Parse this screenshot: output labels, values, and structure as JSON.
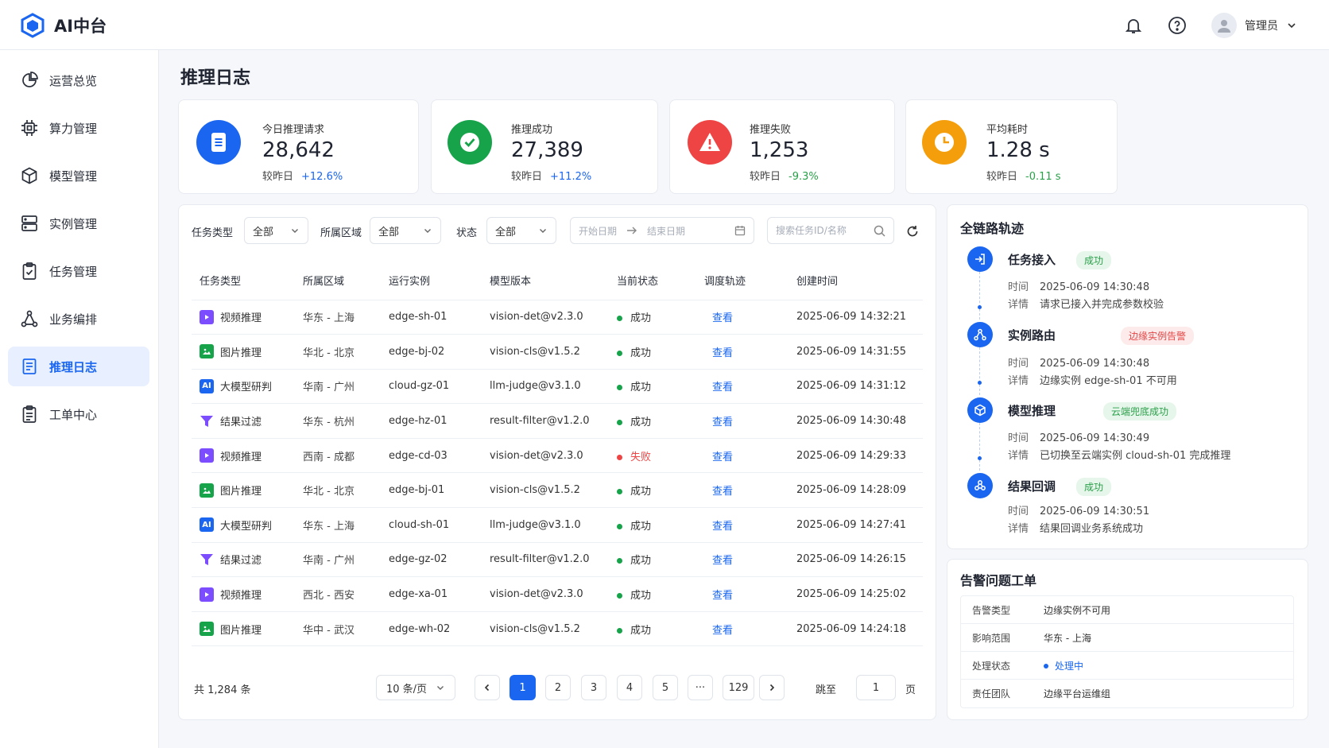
{
  "app": {
    "title": "AI中台"
  },
  "header": {
    "user_name": "管理员",
    "icons": [
      "bell-icon",
      "help-icon",
      "avatar-icon",
      "chevron-down-icon"
    ]
  },
  "sidebar": {
    "items": [
      {
        "label": "运营总览",
        "icon": "pie-chart-icon",
        "active": false
      },
      {
        "label": "算力管理",
        "icon": "cpu-icon",
        "active": false
      },
      {
        "label": "模型管理",
        "icon": "cube-icon",
        "active": false
      },
      {
        "label": "实例管理",
        "icon": "server-icon",
        "active": false
      },
      {
        "label": "任务管理",
        "icon": "clipboard-icon",
        "active": false
      },
      {
        "label": "业务编排",
        "icon": "flow-icon",
        "active": false
      },
      {
        "label": "推理日志",
        "icon": "document-icon",
        "active": true
      },
      {
        "label": "工单中心",
        "icon": "ticket-icon",
        "active": false
      }
    ]
  },
  "page": {
    "title": "推理日志"
  },
  "stats": [
    {
      "label": "今日推理请求",
      "value": "28,642",
      "compare_label": "较昨日",
      "delta": "+12.6%",
      "color": "#1a66f0",
      "icon": "document-icon"
    },
    {
      "label": "推理成功",
      "value": "27,389",
      "compare_label": "较昨日",
      "delta": "+11.2%",
      "color": "#16a34a",
      "icon": "check-circle-icon"
    },
    {
      "label": "推理失败",
      "value": "1,253",
      "compare_label": "较昨日",
      "delta": "-9.3%",
      "color": "#ef4444",
      "icon": "warning-icon"
    },
    {
      "label": "平均耗时",
      "value": "1.28 s",
      "compare_label": "较昨日",
      "delta": "-0.11 s",
      "color": "#f59e0b",
      "icon": "clock-icon"
    }
  ],
  "filters": {
    "task_type": {
      "label": "任务类型",
      "value": "全部"
    },
    "region": {
      "label": "所属区域",
      "value": "全部"
    },
    "status": {
      "label": "状态",
      "value": "全部"
    },
    "date": {
      "start_placeholder": "开始日期",
      "end_placeholder": "结束日期"
    },
    "search_placeholder": "搜索任务ID/名称"
  },
  "table": {
    "columns": [
      "任务类型",
      "所属区域",
      "运行实例",
      "模型版本",
      "当前状态",
      "调度轨迹",
      "创建时间"
    ],
    "link_label": "查看",
    "rows": [
      {
        "type": "视频推理",
        "icon": "video-icon",
        "region": "华东 - 上海",
        "instance": "edge-sh-01",
        "model": "vision-det@v2.3.0",
        "status": "成功",
        "ok": true,
        "time": "2025-06-09 14:32:21"
      },
      {
        "type": "图片推理",
        "icon": "image-icon",
        "region": "华北 - 北京",
        "instance": "edge-bj-02",
        "model": "vision-cls@v1.5.2",
        "status": "成功",
        "ok": true,
        "time": "2025-06-09 14:31:55"
      },
      {
        "type": "大模型研判",
        "icon": "ai-icon",
        "region": "华南 - 广州",
        "instance": "cloud-gz-01",
        "model": "llm-judge@v3.1.0",
        "status": "成功",
        "ok": true,
        "time": "2025-06-09 14:31:12"
      },
      {
        "type": "结果过滤",
        "icon": "filter-icon",
        "region": "华东 - 杭州",
        "instance": "edge-hz-01",
        "model": "result-filter@v1.2.0",
        "status": "成功",
        "ok": true,
        "time": "2025-06-09 14:30:48"
      },
      {
        "type": "视频推理",
        "icon": "video-icon",
        "region": "西南 - 成都",
        "instance": "edge-cd-03",
        "model": "vision-det@v2.3.0",
        "status": "失败",
        "ok": false,
        "time": "2025-06-09 14:29:33"
      },
      {
        "type": "图片推理",
        "icon": "image-icon",
        "region": "华北 - 北京",
        "instance": "edge-bj-01",
        "model": "vision-cls@v1.5.2",
        "status": "成功",
        "ok": true,
        "time": "2025-06-09 14:28:09"
      },
      {
        "type": "大模型研判",
        "icon": "ai-icon",
        "region": "华东 - 上海",
        "instance": "cloud-sh-01",
        "model": "llm-judge@v3.1.0",
        "status": "成功",
        "ok": true,
        "time": "2025-06-09 14:27:41"
      },
      {
        "type": "结果过滤",
        "icon": "filter-icon",
        "region": "华南 - 广州",
        "instance": "edge-gz-02",
        "model": "result-filter@v1.2.0",
        "status": "成功",
        "ok": true,
        "time": "2025-06-09 14:26:15"
      },
      {
        "type": "视频推理",
        "icon": "video-icon",
        "region": "西北 - 西安",
        "instance": "edge-xa-01",
        "model": "vision-det@v2.3.0",
        "status": "成功",
        "ok": true,
        "time": "2025-06-09 14:25:02"
      },
      {
        "type": "图片推理",
        "icon": "image-icon",
        "region": "华中 - 武汉",
        "instance": "edge-wh-02",
        "model": "vision-cls@v1.5.2",
        "status": "成功",
        "ok": true,
        "time": "2025-06-09 14:24:18"
      }
    ]
  },
  "pagination": {
    "total": "共 1,284 条",
    "page_size": "10 条/页",
    "pages": [
      "1",
      "2",
      "3",
      "4",
      "5",
      "···",
      "129"
    ],
    "current": "1",
    "jump_label": "跳至",
    "jump_value": "1",
    "page_unit": "页"
  },
  "trace": {
    "title": "全链路轨迹",
    "time_label": "时间",
    "detail_label": "详情",
    "steps": [
      {
        "title": "任务接入",
        "tag": "成功",
        "tag_kind": "ok",
        "icon": "login-icon",
        "time": "2025-06-09 14:30:48",
        "detail": "请求已接入并完成参数校验"
      },
      {
        "title": "实例路由",
        "tag": "边缘实例告警",
        "tag_kind": "err",
        "icon": "route-icon",
        "time": "2025-06-09 14:30:48",
        "detail": "边缘实例 edge-sh-01 不可用"
      },
      {
        "title": "模型推理",
        "tag": "云端兜底成功",
        "tag_kind": "ok",
        "icon": "cube-icon",
        "time": "2025-06-09 14:30:49",
        "detail": "已切换至云端实例 cloud-sh-01 完成推理"
      },
      {
        "title": "结果回调",
        "tag": "成功",
        "tag_kind": "ok",
        "icon": "callback-icon",
        "time": "2025-06-09 14:30:51",
        "detail": "结果回调业务系统成功"
      }
    ]
  },
  "alert": {
    "title": "告警问题工单",
    "rows": [
      {
        "key": "告警类型",
        "value": "边缘实例不可用"
      },
      {
        "key": "影响范围",
        "value": "华东 - 上海"
      },
      {
        "key": "处理状态",
        "value": "处理中"
      },
      {
        "key": "责任团队",
        "value": "边缘平台运维组"
      }
    ]
  }
}
